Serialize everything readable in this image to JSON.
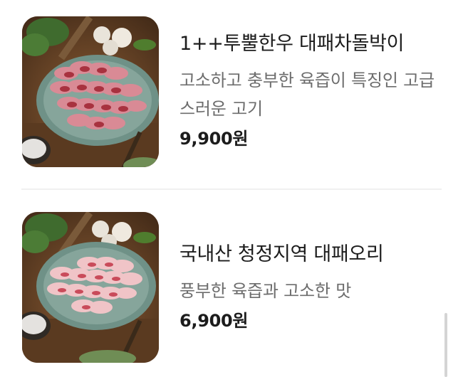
{
  "menu_items": [
    {
      "title": "1++투뿔한우 대패차돌박이",
      "description": "고소하고 충부한 육즙이 특징인 고급스러운 고기",
      "price": "9,900원",
      "image_icon": "sliced-beef-brisket-plate"
    },
    {
      "title": "국내산 청정지역 대패오리",
      "description": "풍부한 육즙과 고소한 맛",
      "price": "6,900원",
      "image_icon": "sliced-duck-plate"
    }
  ]
}
